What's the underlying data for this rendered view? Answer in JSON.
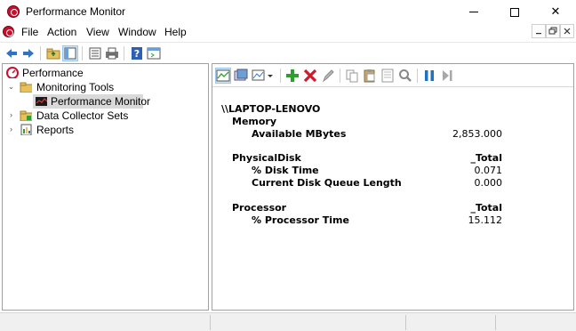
{
  "window": {
    "title": "Performance Monitor",
    "minimize_icon": "minimize-icon",
    "maximize_icon": "maximize-icon",
    "close_glyph": "✕"
  },
  "menu": {
    "items": [
      {
        "label": "File"
      },
      {
        "label": "Action"
      },
      {
        "label": "View"
      },
      {
        "label": "Window"
      },
      {
        "label": "Help"
      }
    ]
  },
  "toolbar": {
    "icons": [
      "back-arrow-icon",
      "forward-arrow-icon",
      "up-folder-icon",
      "show-hide-tree-icon",
      "properties-icon",
      "print-icon",
      "help-icon",
      "console-icon"
    ]
  },
  "tree": {
    "root": "Performance",
    "monitoring_tools": "Monitoring Tools",
    "performance_monitor": "Performance Monitor",
    "data_collector_sets": "Data Collector Sets",
    "reports": "Reports"
  },
  "report": {
    "computer": "\\\\LAPTOP-LENOVO",
    "sections": [
      {
        "object": "Memory",
        "instance": "",
        "counters": [
          {
            "name": "Available MBytes",
            "value": "2,853.000"
          }
        ]
      },
      {
        "object": "PhysicalDisk",
        "instance": "_Total",
        "counters": [
          {
            "name": "% Disk Time",
            "value": "0.071"
          },
          {
            "name": "Current Disk Queue Length",
            "value": "0.000"
          }
        ]
      },
      {
        "object": "Processor",
        "instance": "_Total",
        "counters": [
          {
            "name": "% Processor Time",
            "value": "15.112"
          }
        ]
      }
    ]
  },
  "colors": {
    "accent_green": "#2e9e2e",
    "delete_red": "#d0192b",
    "pause_blue": "#1e73be",
    "selection": "#d9d9d9"
  }
}
